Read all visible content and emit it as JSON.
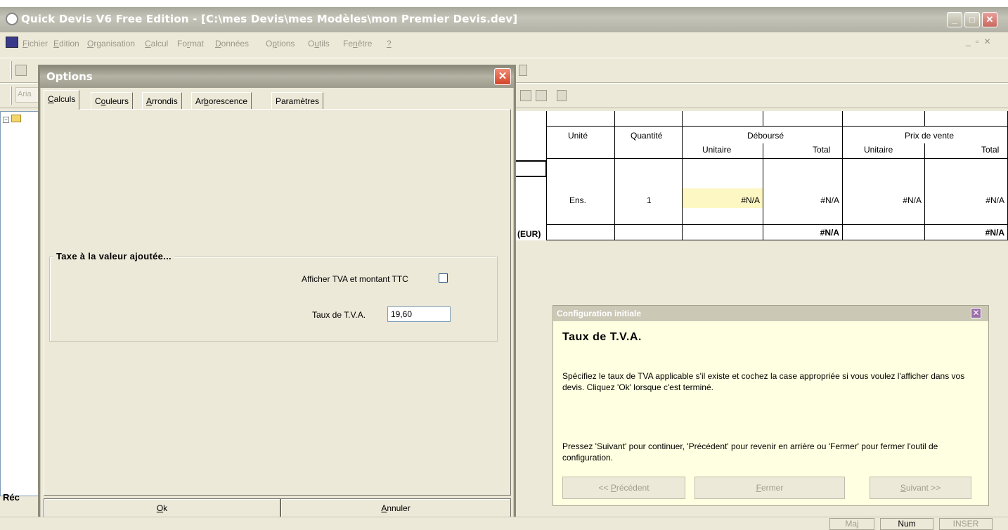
{
  "window": {
    "title": "Quick Devis V6 Free Edition - [C:\\mes Devis\\mes Modèles\\mon Premier Devis.dev]",
    "min": "_",
    "max": "□",
    "close": "✕"
  },
  "menu": {
    "items": [
      {
        "pre": "",
        "u": "F",
        "post": "ichier"
      },
      {
        "pre": "",
        "u": "E",
        "post": "dition"
      },
      {
        "pre": "",
        "u": "O",
        "post": "rganisation"
      },
      {
        "pre": "",
        "u": "C",
        "post": "alcul"
      },
      {
        "pre": "Fo",
        "u": "r",
        "post": "mat"
      },
      {
        "pre": "",
        "u": "D",
        "post": "onnées"
      },
      {
        "pre": "O",
        "u": "p",
        "post": "tions"
      },
      {
        "pre": "O",
        "u": "u",
        "post": "tils"
      },
      {
        "pre": "Fe",
        "u": "n",
        "post": "être"
      },
      {
        "pre": "",
        "u": "?",
        "post": ""
      }
    ],
    "mdi_controls": "_ ▫ ✕"
  },
  "toolbar": {
    "font_stub": "Aria"
  },
  "tree": {
    "bottom_label": "Réc"
  },
  "grid": {
    "headers": {
      "unite": "Unité",
      "quantite": "Quantité",
      "debourse": "Déboursé",
      "prix_vente": "Prix de vente",
      "unitaire": "Unitaire",
      "total": "Total"
    },
    "row": {
      "unite": "Ens.",
      "quantite": "1",
      "debourse_unitaire": "#N/A",
      "debourse_total": "#N/A",
      "pv_unitaire": "#N/A",
      "pv_total": "#N/A"
    },
    "totals": {
      "currency_label": "(EUR)",
      "debourse_total": "#N/A",
      "pv_total": "#N/A"
    }
  },
  "options_dialog": {
    "title": "Options",
    "close": "✕",
    "tabs": [
      {
        "pre": "",
        "u": "C",
        "post": "alculs"
      },
      {
        "pre": "C",
        "u": "o",
        "post": "uleurs"
      },
      {
        "pre": "",
        "u": "A",
        "post": "rrondis"
      },
      {
        "pre": "Ar",
        "u": "b",
        "post": "orescence"
      },
      {
        "pre": "Paramètres",
        "u": "",
        "post": ""
      }
    ],
    "group_title": "Taxe à la valeur ajoutée...",
    "show_vat_label": "Afficher TVA et montant TTC",
    "show_vat_checked": false,
    "vat_rate_label": "Taux de T.V.A.",
    "vat_rate_value": "19,60",
    "ok": {
      "pre": "",
      "u": "O",
      "post": "k"
    },
    "cancel": {
      "pre": "",
      "u": "A",
      "post": "nnuler"
    }
  },
  "config_panel": {
    "title": "Configuration initiale",
    "close": "✕",
    "heading": "Taux de T.V.A.",
    "para1": "Spécifiez le taux de TVA applicable s'il existe et cochez la case appropriée si vous voulez l'afficher dans vos devis. Cliquez 'Ok' lorsque c'est terminé.",
    "para2": "Pressez 'Suivant' pour continuer, 'Précédent' pour revenir en arrière ou 'Fermer' pour fermer l'outil de configuration.",
    "prev": {
      "pre": "<< ",
      "u": "P",
      "post": "récédent"
    },
    "close_btn": {
      "pre": "",
      "u": "F",
      "post": "ermer"
    },
    "next": {
      "pre": "",
      "u": "S",
      "post": "uivant >>"
    }
  },
  "statusbar": {
    "maj": "Maj",
    "num": "Num",
    "inser": "INSER"
  },
  "colors": {
    "title_gray": "#b2b2a6",
    "dialog_close": "#d4452a",
    "tip_bg": "#ffffe1",
    "highlight": "#fdf7c3"
  }
}
